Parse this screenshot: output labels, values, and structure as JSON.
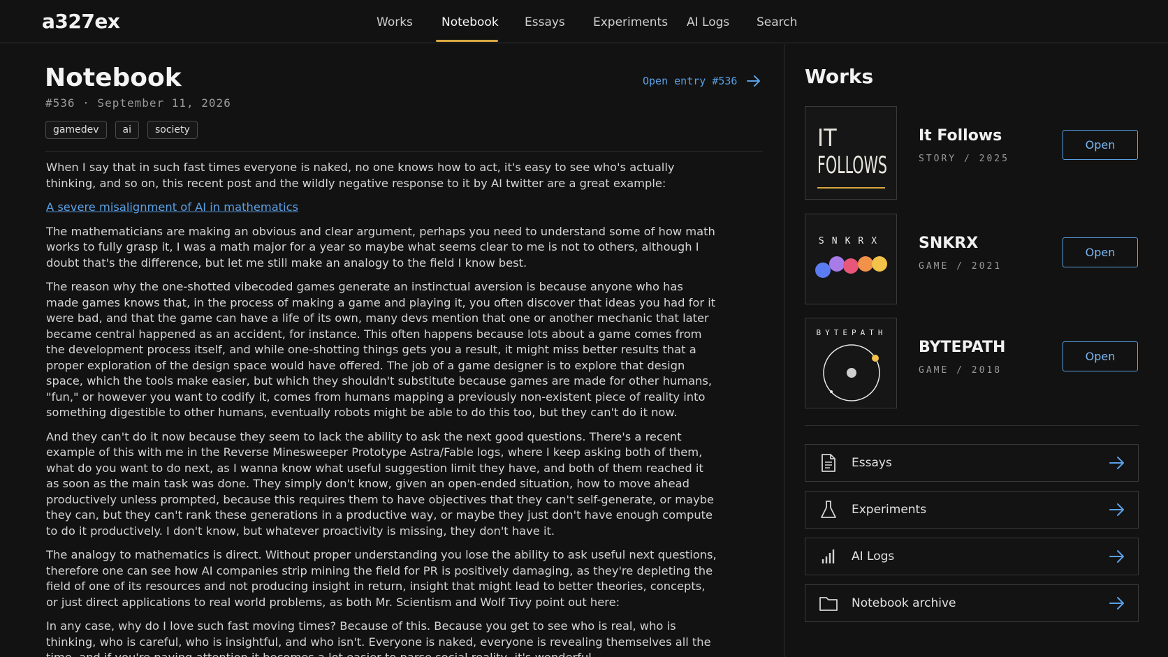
{
  "brand": "a327ex",
  "nav": [
    "Works",
    "Notebook",
    "Essays",
    "Experiments",
    "AI Logs",
    "Search"
  ],
  "accent_color": "#d9a840",
  "link_color": "#5aa0e6",
  "entry": {
    "title": "Notebook",
    "meta": "#536 · September 11, 2026",
    "open_link": "Open entry #536",
    "tags": [
      "gamedev",
      "ai",
      "society"
    ],
    "paragraphs": [
      "When I say that in such fast times everyone is naked, no one knows how to act, it's easy to see who's actually thinking, and so on, this recent post and the wildly negative response to it by AI twitter are a great example:",
      "The mathematicians are making an obvious and clear argument, perhaps you need to understand some of how math works to fully grasp it, I was a math major for a year so maybe what seems clear to me is not to others, although I doubt that's the difference, but let me still make an analogy to the field I know best.",
      "The reason why the one-shotted vibecoded games generate an instinctual aversion is because anyone who has made games knows that, in the process of making a game and playing it, you often discover that ideas you had for it were bad, and that the game can have a life of its own, many devs mention that one or another mechanic that later became central happened as an accident, for instance. This often happens because lots about a game comes from the development process itself, and while one-shotting things gets you a result, it might miss better results that a proper exploration of the design space would have offered. The job of a game designer is to explore that design space, which the tools make easier, but which they shouldn't substitute because games are made for other humans, \"fun,\" or however you want to codify it, comes from humans mapping a previously non-existent piece of reality into something digestible to other humans, eventually robots might be able to do this too, but they can't do it now.",
      "And they can't do it now because they seem to lack the ability to ask the next good questions. There's a recent example of this with me in the Reverse Minesweeper Prototype Astra/Fable logs, where I keep asking both of them, what do you want to do next, as I wanna know what useful suggestion limit they have, and both of them reached it as soon as the main task was done. They simply don't know, given an open-ended situation, how to move ahead productively unless prompted, because this requires them to have objectives that they can't self-generate, or maybe they can, but they can't rank these generations in a productive way, or maybe they just don't have enough compute to do it productively. I don't know, but whatever proactivity is missing, they don't have it.",
      "The analogy to mathematics is direct. Without proper understanding you lose the ability to ask useful next questions, therefore one can see how AI companies strip mining the field for PR is positively damaging, as they're depleting the field of one of its resources and not producing insight in return, insight that might lead to better theories, concepts, or just direct applications to real world problems, as both Mr. Scientism and Wolf Tivy point out here:",
      "In any case, why do I love such fast moving times? Because of this. Because you get to see who is real, who is thinking, who is careful, who is insightful, and who isn't. Everyone is naked, everyone is revealing themselves all the time, and if you're paying attention it becomes a lot easier to parse social reality, it's wonderful."
    ],
    "link_text": "A severe misalignment of AI in mathematics"
  },
  "sidebar": {
    "title": "Works",
    "works": [
      {
        "title": "It Follows",
        "meta": "STORY / 2025",
        "button": "Open",
        "thumb_text": [
          "IT",
          "FOLLOWS"
        ],
        "icon": "it-follows-thumbnail"
      },
      {
        "title": "SNKRX",
        "meta": "GAME / 2021",
        "button": "Open",
        "thumb_text": "SNKRX",
        "dot_colors": [
          "#5b7cf0",
          "#a87be8",
          "#e8567a",
          "#f2914a",
          "#f2c24a"
        ],
        "icon": "snkrx-thumbnail"
      },
      {
        "title": "BYTEPATH",
        "meta": "GAME / 2018",
        "button": "Open",
        "thumb_text": "BYTEPATH",
        "icon": "bytepath-thumbnail"
      }
    ],
    "links": [
      {
        "label": "Essays",
        "icon": "document-icon"
      },
      {
        "label": "Experiments",
        "icon": "flask-icon"
      },
      {
        "label": "AI Logs",
        "icon": "bar-chart-icon"
      },
      {
        "label": "Notebook archive",
        "icon": "folder-icon"
      }
    ]
  }
}
